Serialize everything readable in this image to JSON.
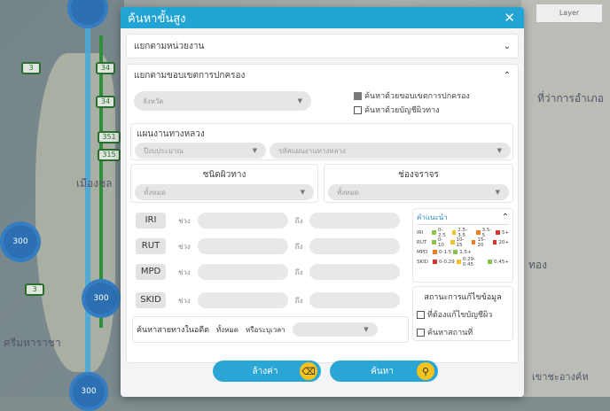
{
  "map": {
    "layer_label": "Layer",
    "labels": [
      "เมืองชล",
      "ที่ว่าการอำเภอ",
      "ศรีมหาราชา",
      "ทอง",
      "เขาชะอางค์ห"
    ],
    "clusters": [
      "300",
      "300",
      "300"
    ],
    "shields": [
      "3",
      "34",
      "34",
      "351",
      "315",
      "3"
    ]
  },
  "modal": {
    "title": "ค้นหาขั้นสูง",
    "close_icon": "close-icon",
    "section_agency": "แยกตามหน่วยงาน",
    "section_admin": "แยกตามขอบเขตการปกครอง",
    "province_placeholder": "จังหวัด",
    "check_admin_boundary": "ค้นหาด้วยขอบเขตการปกครอง",
    "check_road_list": "ค้นหาด้วยบัญชีผิวทาง",
    "highway_plan_label": "แผนงานทางหลวง",
    "budget_year_placeholder": "ปีงบประมาณ",
    "highway_plan_code_placeholder": "รหัสแผนงานทางหลวง",
    "surface_type_label": "ชนิดผิวทาง",
    "lane_label": "ช่องจราจร",
    "all_placeholder_1": "ทั้งหมด",
    "all_placeholder_2": "ทั้งหมด",
    "range_label": "ช่วง",
    "to_label": "ถึง",
    "metrics": [
      "IRI",
      "RUT",
      "MPD",
      "SKID"
    ],
    "history_label": "ค้นหาสายทางในอดีต",
    "history_all": "ทั้งหมด",
    "history_or": "หรือระบุเวลา",
    "advice": {
      "title": "คำแนะนำ",
      "rows": [
        {
          "name": "IRI",
          "items": [
            "0-2.5",
            "2.5-3.5",
            "3.5-5",
            "5+"
          ]
        },
        {
          "name": "RUT",
          "items": [
            "0-10",
            "10-15",
            "15-20",
            "20+"
          ]
        },
        {
          "name": "MPD",
          "items": [
            "0-1.5",
            "1.5+"
          ]
        },
        {
          "name": "SKID",
          "items": [
            "0-0.29",
            "0.29-0.45",
            "0.45+"
          ]
        }
      ]
    },
    "status_title": "สถานะการแก้ไขข้อมูล",
    "status_check_1": "ที่ต้องแก้ไขบัญชีผิว",
    "status_check_2": "ค้นหาสถานที่",
    "clear_button": "ล้างค่า",
    "search_button": "ค้นหา"
  },
  "colors": {
    "header": "#22a4d4",
    "button": "#2aa6d6",
    "button_icon": "#f6c21c",
    "legend_green": "#8ac34a",
    "legend_yellow": "#f2c12e",
    "legend_orange": "#ef7d22",
    "legend_red": "#d9342b"
  }
}
